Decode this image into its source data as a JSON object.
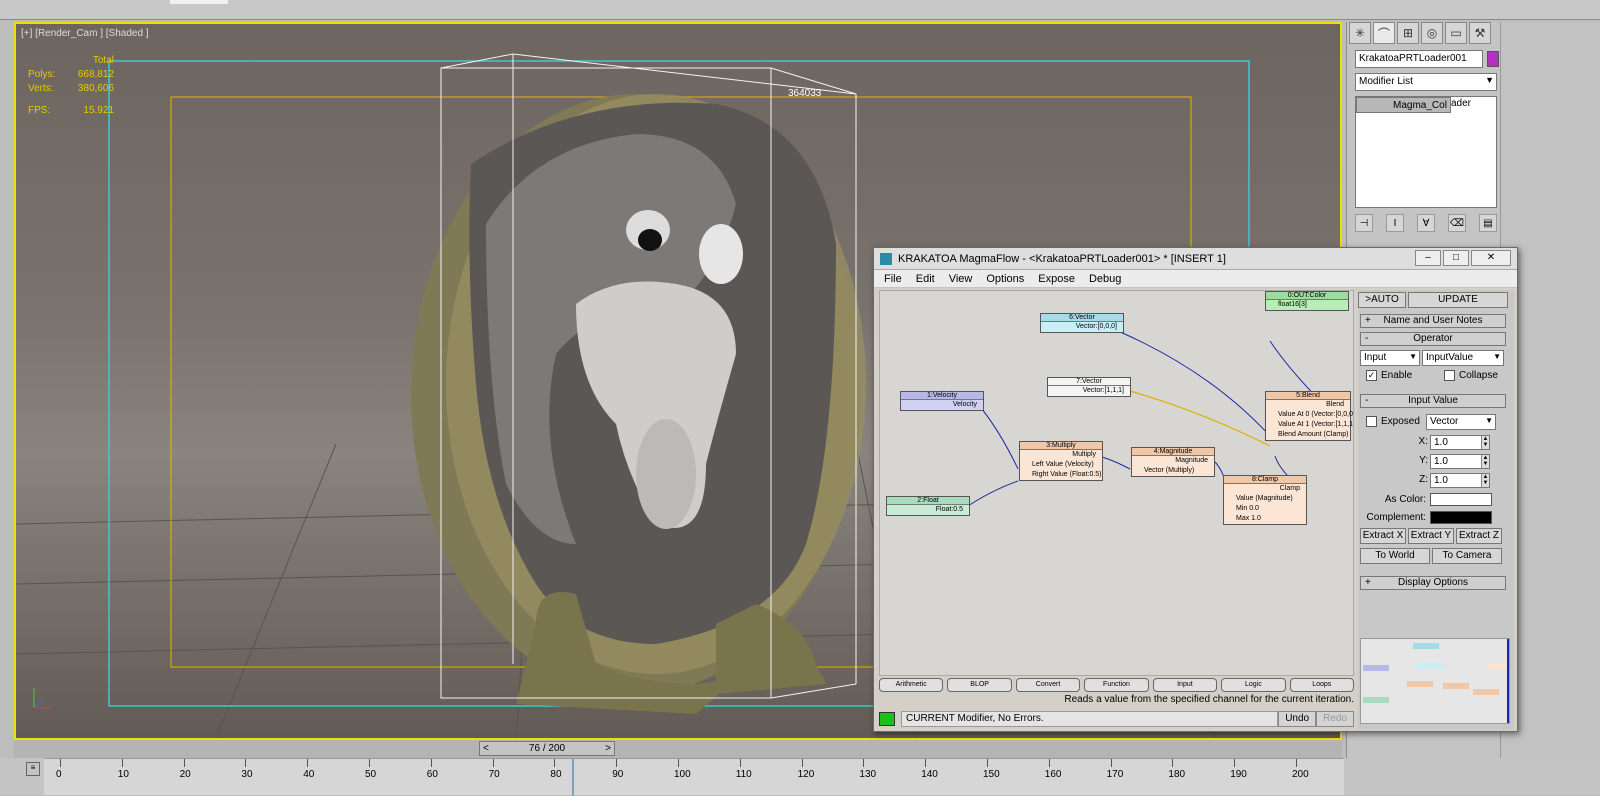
{
  "viewport": {
    "label": "[+] [Render_Cam ] [Shaded ]",
    "stats": {
      "total_label": "Total",
      "polys_label": "Polys:",
      "polys_value": "668,812",
      "verts_label": "Verts:",
      "verts_value": "380,606",
      "fps_label": "FPS:",
      "fps_value": "15.921"
    },
    "bbox_label": "364033"
  },
  "command_panel": {
    "object_name": "KrakatoaPRTLoader001",
    "object_color": "#b22fc2",
    "modifier_list": "Modifier List",
    "stack": [
      "Magma_Col",
      "KrakatoaPRTLoader"
    ]
  },
  "magmaflow": {
    "title": "KRAKATOA MagmaFlow - <KrakatoaPRTLoader001> *  [INSERT 1]",
    "menu": [
      "File",
      "Edit",
      "View",
      "Options",
      "Expose",
      "Debug"
    ],
    "nodes": {
      "out": {
        "header": "0:OUT:Color",
        "rows": [
          "float16[3]"
        ]
      },
      "vec6": {
        "header": "6:Vector",
        "rows": [
          "Vector:[0,0,0]"
        ]
      },
      "vec7": {
        "header": "7:Vector",
        "rows": [
          "Vector:[1,1,1]"
        ]
      },
      "vel": {
        "header": "1:Velocity",
        "rows": [
          "Velocity"
        ]
      },
      "mult": {
        "header": "3:Multiply",
        "rows": [
          "Multiply",
          "Left Value (Velocity)",
          "Right Value (Float:0.5)"
        ]
      },
      "mag": {
        "header": "4:Magnitude",
        "rows": [
          "Magnitude",
          "Vector (Multiply)"
        ]
      },
      "blend": {
        "header": "5:Blend",
        "rows": [
          "Blend",
          "Value At 0 (Vector:[0,0,0",
          "Value At 1 (Vector:[1,1,1",
          "Blend Amount (Clamp)"
        ]
      },
      "clamp": {
        "header": "8:Clamp",
        "rows": [
          "Clamp",
          "Value (Magnitude)",
          "Min 0.0",
          "Max 1.0"
        ]
      },
      "float": {
        "header": "2:Float",
        "rows": [
          "Float:0.5"
        ]
      }
    },
    "categories": [
      "Arithmetic",
      "BLOP",
      "Convert",
      "Function",
      "Input",
      "Logic",
      "Loops"
    ],
    "description": "Reads a value from the specified channel for the current iteration.",
    "status": "CURRENT Modifier, No Errors.",
    "undo": "Undo",
    "redo": "Redo",
    "side": {
      "auto": ">AUTO",
      "update": "UPDATE",
      "rollout_name": "Name and User Notes",
      "rollout_operator": "Operator",
      "op_category": "Input",
      "op_type": "InputValue",
      "enable": "Enable",
      "collapse": "Collapse",
      "rollout_input": "Input Value",
      "exposed": "Exposed",
      "type": "Vector",
      "x_label": "X:",
      "x_value": "1.0",
      "y_label": "Y:",
      "y_value": "1.0",
      "z_label": "Z:",
      "z_value": "1.0",
      "as_color": "As Color:",
      "complement": "Complement:",
      "as_color_value": "#ffffff",
      "complement_value": "#000000",
      "extract_x": "Extract X",
      "extract_y": "Extract Y",
      "extract_z": "Extract Z",
      "to_world": "To World",
      "to_camera": "To Camera",
      "rollout_display": "Display Options"
    }
  },
  "timeline": {
    "frame": "76 / 200",
    "prev": "<",
    "next": ">",
    "ticks": [
      "0",
      "10",
      "20",
      "30",
      "40",
      "50",
      "60",
      "70",
      "80",
      "90",
      "100",
      "110",
      "120",
      "130",
      "140",
      "150",
      "160",
      "170",
      "180",
      "190",
      "200"
    ]
  }
}
